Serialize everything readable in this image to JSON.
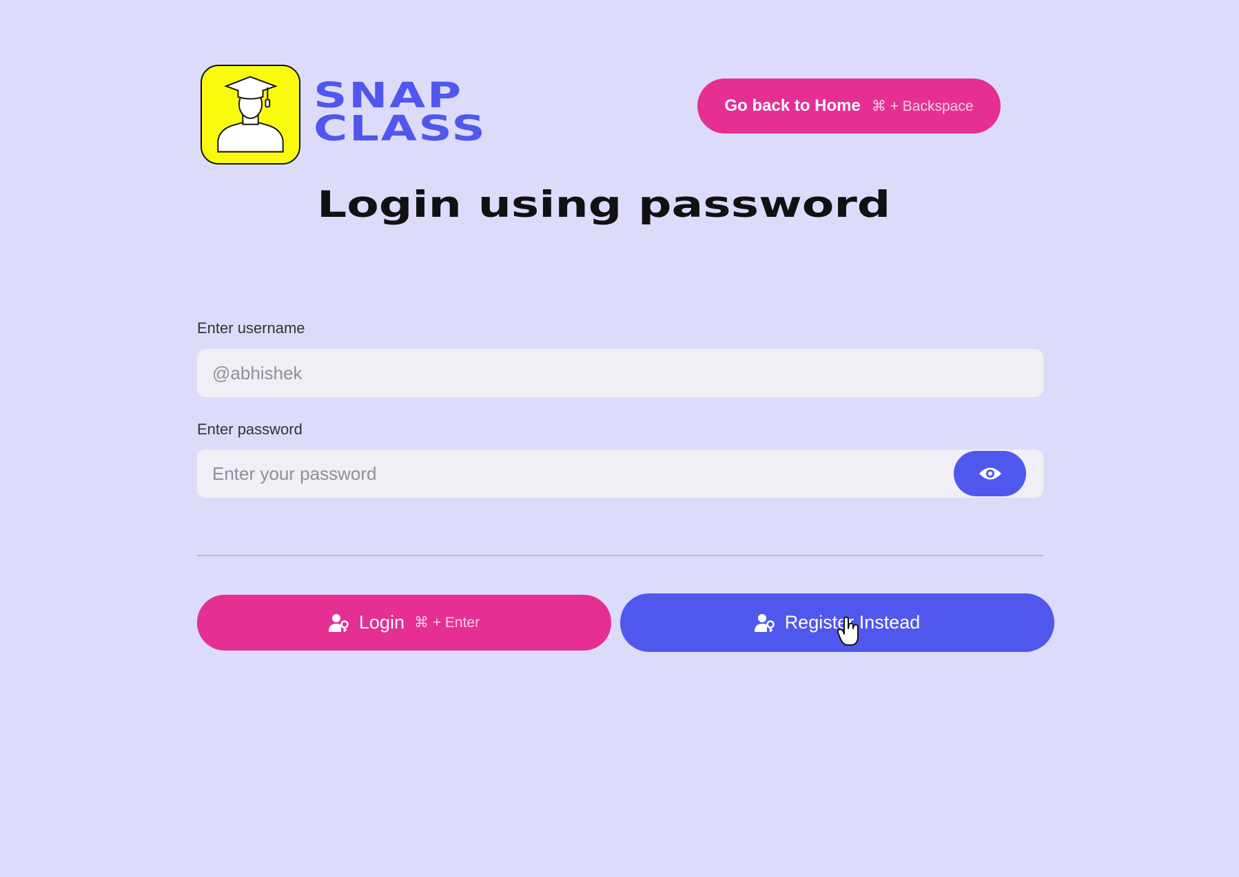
{
  "brand": {
    "line1": "SNAP",
    "line2": "CLASS",
    "logo_icon": "graduate-silhouette-icon"
  },
  "header": {
    "home_button_label": "Go back to Home",
    "home_shortcut": "⌘ + Backspace"
  },
  "page_title": "Login using password",
  "form": {
    "username_label": "Enter username",
    "username_placeholder": "@abhishek",
    "password_label": "Enter password",
    "password_placeholder": "Enter your password",
    "toggle_icon": "eye-icon"
  },
  "actions": {
    "login_label": "Login",
    "login_shortcut": "⌘ + Enter",
    "register_label": "Register Instead",
    "button_icon": "user-key-icon"
  },
  "colors": {
    "background": "#dcdcfa",
    "primary_blue": "#5057ec",
    "primary_pink": "#e52f93",
    "logo_yellow": "#fafa0f"
  }
}
